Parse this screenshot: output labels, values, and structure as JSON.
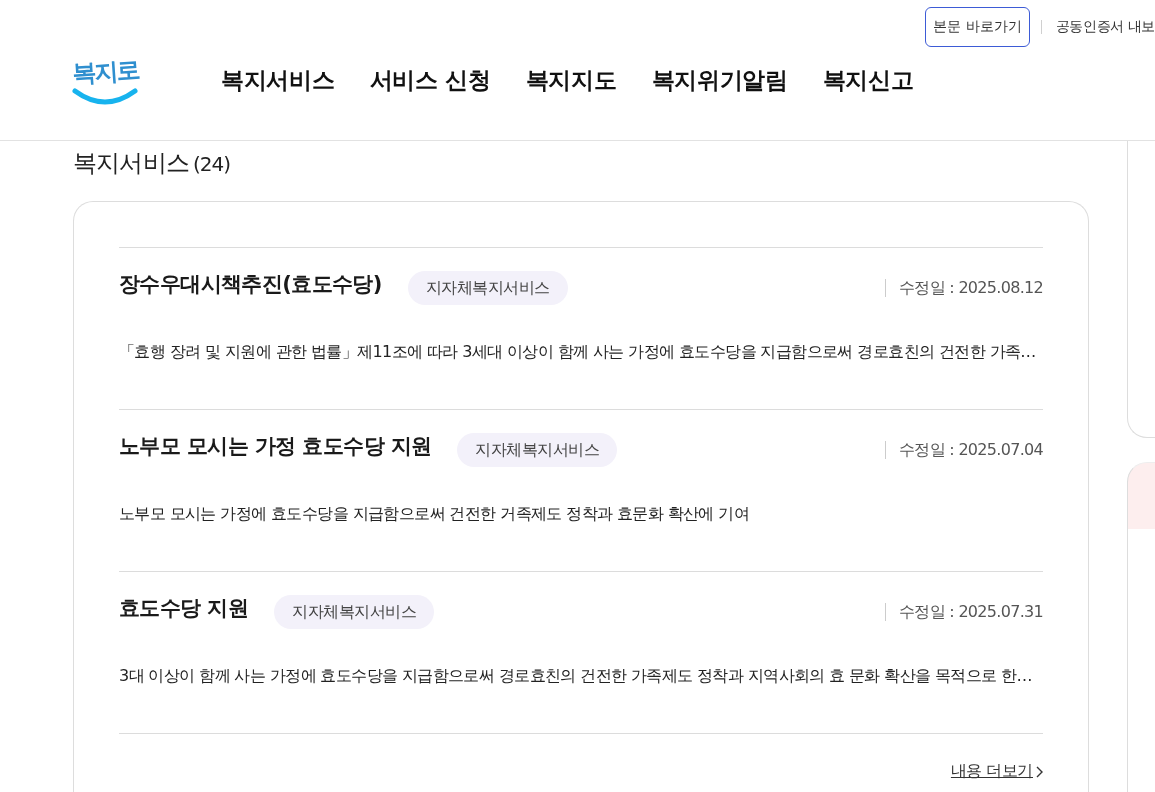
{
  "header": {
    "skip_link": "본문 바로가기",
    "utility_links": [
      "공동인증서 내보"
    ],
    "logo": "복지로",
    "nav": [
      "복지서비스",
      "서비스 신청",
      "복지지도",
      "복지위기알림",
      "복지신고"
    ]
  },
  "section": {
    "title": "복지서비스",
    "count": "(24)"
  },
  "services": [
    {
      "title": "장수우대시책추진(효도수당)",
      "tag": "지자체복지서비스",
      "modified": "수정일 : 2025.08.12",
      "description": "「효행 장려 및 지원에 관한 법률」제11조에 따라 3세대 이상이 함께 사는 가정에 효도수당을 지급함으로써 경로효친의 건전한 가족…"
    },
    {
      "title": "노부모 모시는 가정 효도수당 지원",
      "tag": "지자체복지서비스",
      "modified": "수정일 : 2025.07.04",
      "description": "노부모 모시는 가정에 효도수당을 지급함으로써 건전한 거족제도 정착과 효문화 확산에 기여"
    },
    {
      "title": "효도수당 지원",
      "tag": "지자체복지서비스",
      "modified": "수정일 : 2025.07.31",
      "description": "3대 이상이 함께 사는 가정에 효도수당을 지급함으로써 경로효친의 건전한 가족제도 정착과 지역사회의 효 문화 확산을 목적으로 한…"
    }
  ],
  "more_link": "내용 더보기"
}
